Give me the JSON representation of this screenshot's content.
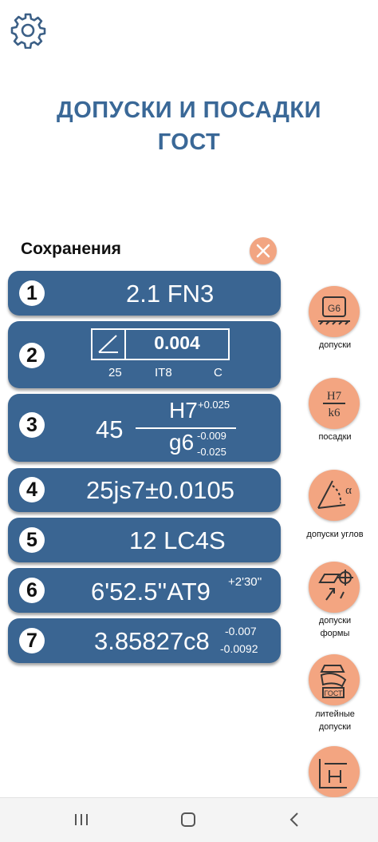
{
  "header": {
    "settings_icon": "gear-icon",
    "title_line1": "ДОПУСКИ И ПОСАДКИ",
    "title_line2": "ГОСТ"
  },
  "saves": {
    "label": "Сохранения",
    "close_icon": "close-icon",
    "items": [
      {
        "number": "1",
        "text": "2.1 FN3"
      },
      {
        "number": "2",
        "value": "0.004",
        "labels": [
          "25",
          "IT8",
          "C"
        ],
        "symbol_icon": "angularity-symbol-icon"
      },
      {
        "number": "3",
        "nominal": "45",
        "hole": "H7",
        "hole_upper": "+0.025",
        "shaft": "g6",
        "shaft_upper": "-0.009",
        "shaft_lower": "-0.025"
      },
      {
        "number": "4",
        "text": "25js7±0.0105"
      },
      {
        "number": "5",
        "text": "12 LC4S"
      },
      {
        "number": "6",
        "text": "6'52.5''AT9",
        "sup": "+2'30''"
      },
      {
        "number": "7",
        "text": "3.85827c8",
        "upper": "-0.007",
        "lower": "-0.0092"
      }
    ]
  },
  "sidebar": {
    "items": [
      {
        "label": "допуски",
        "icon": "tolerance-g6-icon",
        "icon_text": "G6"
      },
      {
        "label": "посадки",
        "icon": "fit-fraction-icon",
        "icon_top": "H7",
        "icon_bottom": "k6"
      },
      {
        "label": "допуски углов",
        "icon": "angle-icon",
        "icon_text": "α"
      },
      {
        "label_line1": "допуски",
        "label_line2": "формы",
        "icon": "form-tolerance-icon"
      },
      {
        "label_line1": "литейные",
        "label_line2": "допуски",
        "icon": "casting-icon",
        "icon_text": "ГОСТ"
      },
      {
        "label": "",
        "icon": "dimension-chain-icon"
      }
    ]
  },
  "navbar": {
    "recent_icon": "recent-apps-icon",
    "home_icon": "home-icon",
    "back_icon": "back-icon"
  },
  "colors": {
    "title": "#3a6897",
    "card": "#3a6592",
    "accent": "#f3a581"
  }
}
